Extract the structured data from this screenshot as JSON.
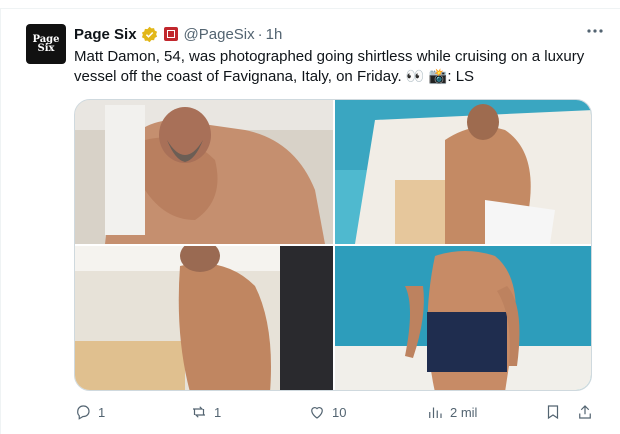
{
  "author": {
    "display_name": "Page Six",
    "handle": "@PageSix",
    "separator": "·",
    "time": "1h",
    "avatar_text": "Page Six"
  },
  "tweet": {
    "text": "Matt Damon, 54, was photographed going shirtless while cruising on a luxury vessel off the coast of Favignana, Italy, on Friday. 👀 📸: LS"
  },
  "actions": {
    "replies": "1",
    "reposts": "1",
    "likes": "10",
    "views": "2 mil"
  },
  "colors": {
    "accent": "#1d9bf0",
    "text": "#0f1419",
    "muted": "#536471",
    "verified": "#e2b719",
    "affiliate": "#c1272d"
  },
  "icons": {
    "verified": "verified-badge-icon",
    "affiliate": "page-six-affiliate-icon",
    "more": "more-icon",
    "reply": "reply-icon",
    "repost": "repost-icon",
    "like": "heart-icon",
    "views": "views-icon",
    "bookmark": "bookmark-icon",
    "share": "share-icon"
  }
}
